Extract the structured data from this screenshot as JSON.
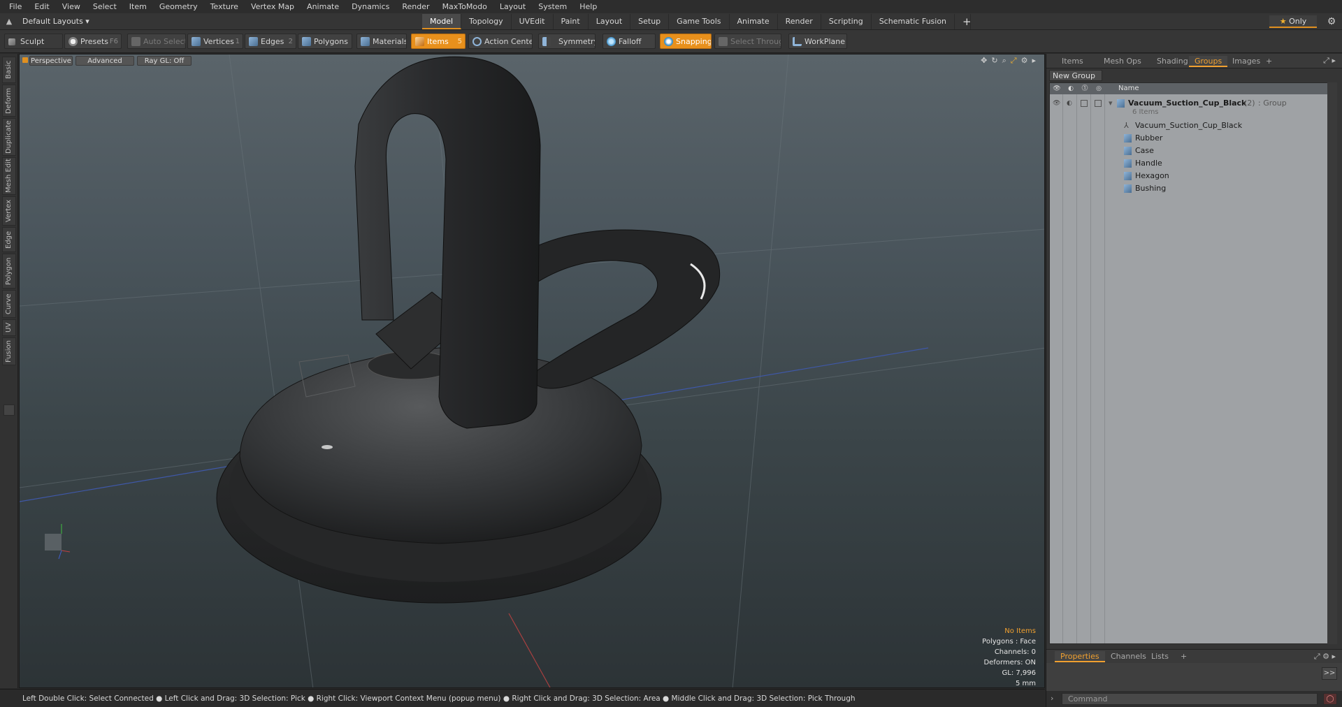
{
  "menubar": [
    "File",
    "Edit",
    "View",
    "Select",
    "Item",
    "Geometry",
    "Texture",
    "Vertex Map",
    "Animate",
    "Dynamics",
    "Render",
    "MaxToModo",
    "Layout",
    "System",
    "Help"
  ],
  "layout": {
    "dropdown": "Default Layouts ▾"
  },
  "tabs": [
    "Model",
    "Topology",
    "UVEdit",
    "Paint",
    "Layout",
    "Setup",
    "Game Tools",
    "Animate",
    "Render",
    "Scripting",
    "Schematic Fusion"
  ],
  "tab_add": "+",
  "only_label": "Only",
  "toolbar": {
    "sculpt": "Sculpt",
    "presets": "Presets",
    "presets_key": "F6",
    "auto_select": "Auto Select",
    "vertices": "Vertices",
    "vertices_key": "1",
    "edges": "Edges",
    "edges_key": "2",
    "polygons": "Polygons",
    "materials": "Materials",
    "items": "Items",
    "items_key": "5",
    "action_center": "Action Center",
    "symmetry": "Symmetry",
    "falloff": "Falloff",
    "snapping": "Snapping",
    "select_through": "Select Through",
    "workplane": "WorkPlane"
  },
  "left_tabs": [
    "Basic",
    "Deform",
    "Duplicate",
    "Mesh Edit",
    "Vertex",
    "Edge",
    "Polygon",
    "Curve",
    "UV",
    "Fusion"
  ],
  "viewport": {
    "perspective": "Perspective",
    "advanced": "Advanced",
    "raygl": "Ray GL: Off",
    "info": {
      "no_items": "No Items",
      "polygons": "Polygons : Face",
      "channels": "Channels: 0",
      "deformers": "Deformers: ON",
      "gl": "GL: 7,996",
      "scale": "5 mm"
    }
  },
  "status": "Left Double Click: Select Connected ● Left Click and Drag: 3D Selection: Pick ● Right Click: Viewport Context Menu (popup menu) ● Right Click and Drag: 3D Selection: Area ● Middle Click and Drag: 3D Selection: Pick Through",
  "right_panel": {
    "tabs": [
      "Items",
      "Mesh Ops",
      "Shading",
      "Groups",
      "Images"
    ],
    "tab_add": "+",
    "new_group": "New Group",
    "name_header": "Name",
    "group": {
      "name": "Vacuum_Suction_Cup_Black",
      "count": "(2)",
      "type": ": Group",
      "items_label": "6 Items"
    },
    "children": [
      "Vacuum_Suction_Cup_Black",
      "Rubber",
      "Case",
      "Handle",
      "Hexagon",
      "Bushing"
    ],
    "bottom_tabs": [
      "Properties",
      "Channels",
      "Lists"
    ],
    "bottom_add": "+",
    "expand": ">>",
    "command_placeholder": "Command"
  },
  "colors": {
    "accent": "#e8901c",
    "panel": "#353535",
    "list_bg": "#9fa2a5"
  }
}
